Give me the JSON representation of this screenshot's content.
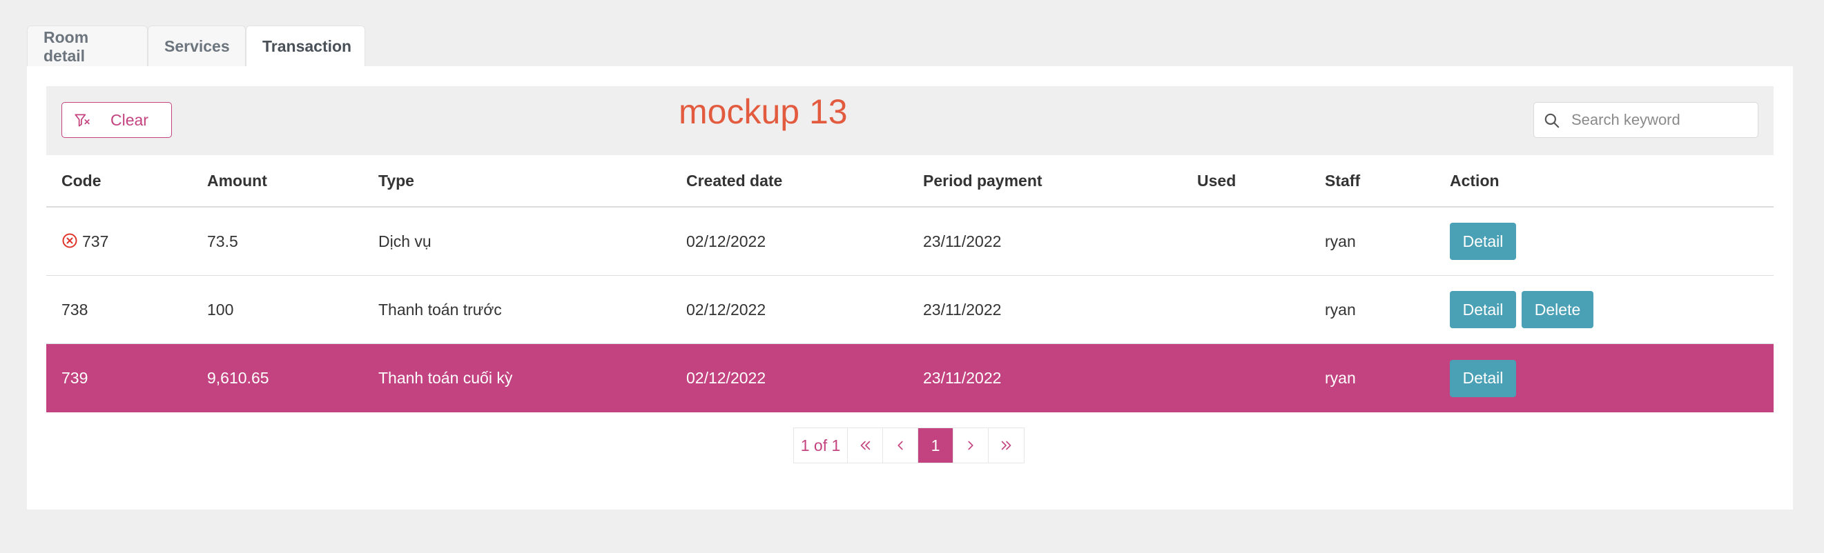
{
  "tabs": [
    {
      "label": "Room detail"
    },
    {
      "label": "Services"
    },
    {
      "label": "Transaction",
      "active": true
    }
  ],
  "toolbar": {
    "clear_label": "Clear",
    "clear_icon": "filter-clear-icon",
    "mockup_label": "mockup 13",
    "search_placeholder": "Search keyword",
    "search_value": "",
    "search_icon": "search-icon"
  },
  "table": {
    "columns": [
      "Code",
      "Amount",
      "Type",
      "Created date",
      "Period payment",
      "Used",
      "Staff",
      "Action"
    ],
    "rows": [
      {
        "code": "737",
        "amount": "73.5",
        "type": "Dịch vụ",
        "created": "02/12/2022",
        "period": "23/11/2022",
        "used": "",
        "staff": "ryan",
        "status_icon": "cancel-circle-icon",
        "actions": [
          "Detail"
        ]
      },
      {
        "code": "738",
        "amount": "100",
        "type": "Thanh toán trước",
        "created": "02/12/2022",
        "period": "23/11/2022",
        "used": "",
        "staff": "ryan",
        "actions": [
          "Detail",
          "Delete"
        ]
      },
      {
        "code": "739",
        "amount": "9,610.65",
        "type": "Thanh toán cuối kỳ",
        "created": "02/12/2022",
        "period": "23/11/2022",
        "used": "",
        "staff": "ryan",
        "selected": true,
        "actions": [
          "Detail"
        ]
      }
    ]
  },
  "pagination": {
    "info": "1 of 1",
    "current_page": "1"
  },
  "colors": {
    "accent": "#c24380",
    "action_button": "#4aa0b5",
    "mockup_text": "#e35b3f",
    "error_icon": "#e0352b"
  }
}
